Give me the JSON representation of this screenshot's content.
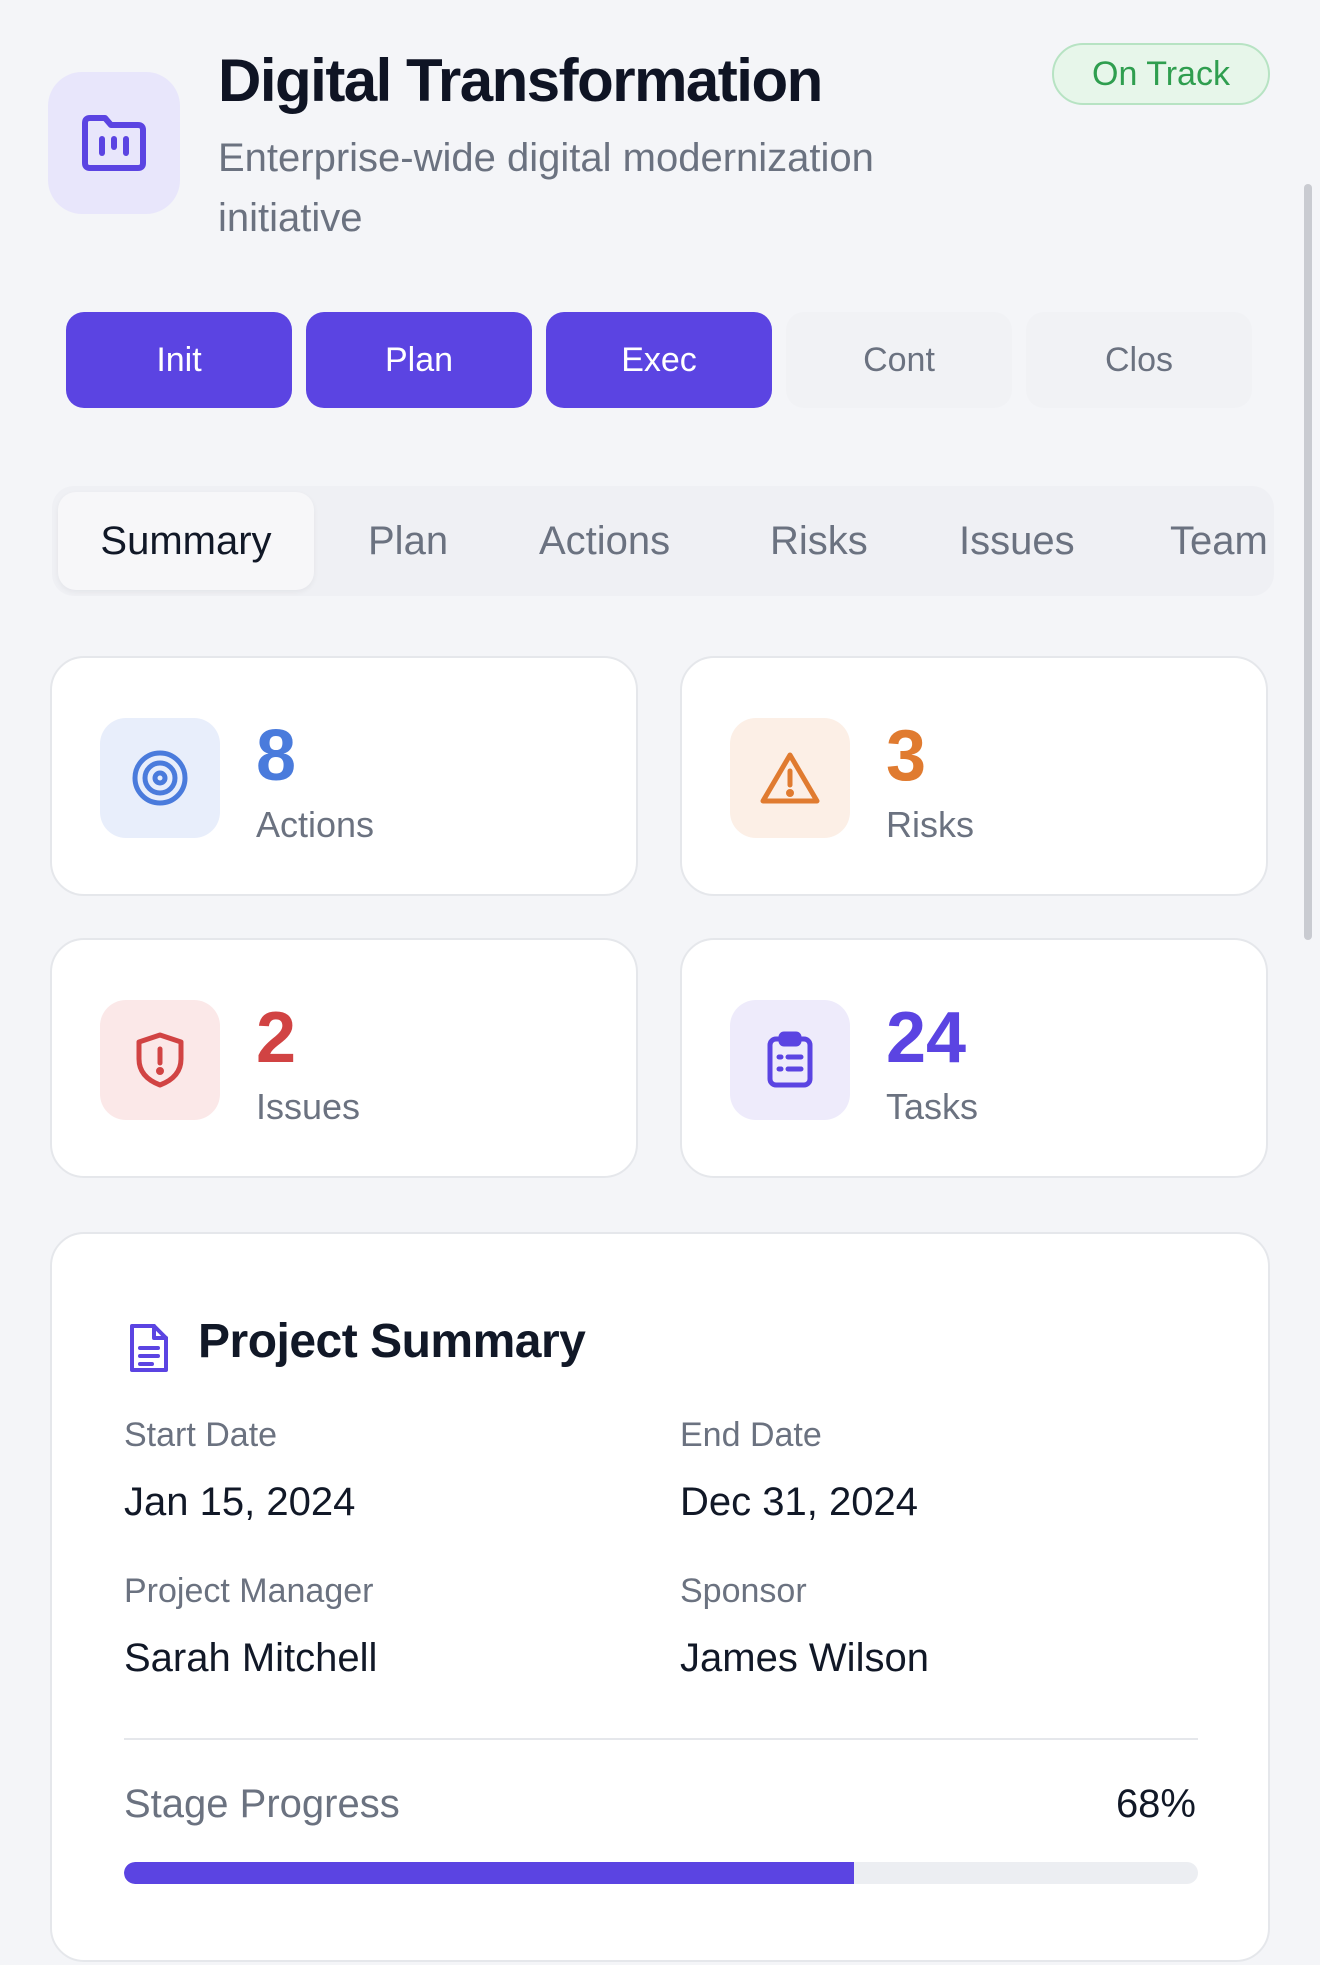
{
  "header": {
    "title": "Digital Transformation",
    "subtitle": "Enterprise-wide digital modernization initiative",
    "status": "On Track",
    "icon": "folder-chart-icon",
    "accent_color": "#5b44e2",
    "status_color": "#2f9e4f"
  },
  "stages": [
    {
      "label": "Init",
      "state": "done"
    },
    {
      "label": "Plan",
      "state": "done"
    },
    {
      "label": "Exec",
      "state": "done"
    },
    {
      "label": "Cont",
      "state": "pending"
    },
    {
      "label": "Clos",
      "state": "pending"
    }
  ],
  "tabs": [
    {
      "label": "Summary",
      "active": true
    },
    {
      "label": "Plan",
      "active": false
    },
    {
      "label": "Actions",
      "active": false
    },
    {
      "label": "Risks",
      "active": false
    },
    {
      "label": "Issues",
      "active": false
    },
    {
      "label": "Team",
      "active": false
    }
  ],
  "stats": [
    {
      "value": "8",
      "label": "Actions",
      "icon": "target-icon",
      "color": "#4a7bdc",
      "bg": "#e8eefb"
    },
    {
      "value": "3",
      "label": "Risks",
      "icon": "warning-triangle-icon",
      "color": "#e07b30",
      "bg": "#fcefe6"
    },
    {
      "value": "2",
      "label": "Issues",
      "icon": "shield-alert-icon",
      "color": "#d14343",
      "bg": "#fbe8e8"
    },
    {
      "value": "24",
      "label": "Tasks",
      "icon": "clipboard-list-icon",
      "color": "#5b44e2",
      "bg": "#eeebfb"
    }
  ],
  "summary": {
    "title": "Project Summary",
    "icon": "document-icon",
    "start_label": "Start Date",
    "start_value": "Jan 15, 2024",
    "end_label": "End Date",
    "end_value": "Dec 31, 2024",
    "manager_label": "Project Manager",
    "manager_value": "Sarah Mitchell",
    "sponsor_label": "Sponsor",
    "sponsor_value": "James Wilson",
    "progress_label": "Stage Progress",
    "progress_text": "68%",
    "progress_value": 0.68
  }
}
